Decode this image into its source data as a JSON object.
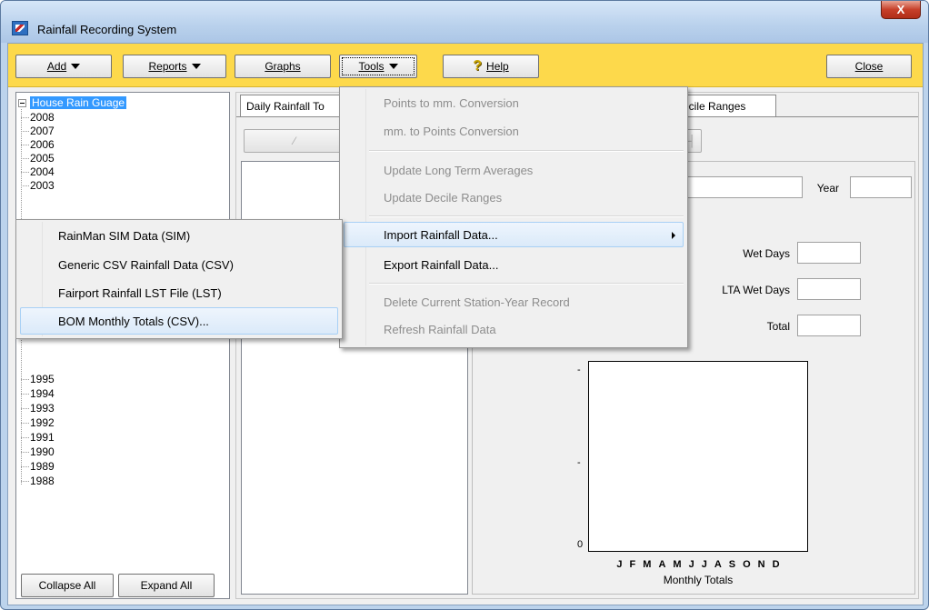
{
  "window": {
    "title": "Rainfall Recording System",
    "close_glyph": "X"
  },
  "toolbar": {
    "add": "Add",
    "reports": "Reports",
    "graphs": "Graphs",
    "tools": "Tools",
    "help": "Help",
    "close": "Close"
  },
  "tree": {
    "root": "House Rain Guage",
    "years_top": [
      "2008",
      "2007",
      "2006",
      "2005",
      "2004",
      "2003"
    ],
    "years_bottom": [
      "1995",
      "1994",
      "1993",
      "1992",
      "1991",
      "1990",
      "1989",
      "1988"
    ],
    "collapse_all": "Collapse All",
    "expand_all": "Expand All"
  },
  "tabs": {
    "daily": "Daily Rainfall To",
    "decile": "ecile Ranges"
  },
  "fields": {
    "year": "Year",
    "wet_days": "Wet Days",
    "lta_wet_days": "LTA Wet Days",
    "total": "Total"
  },
  "chart": {
    "y_zero": "0",
    "y_dash": "-",
    "months": [
      "J",
      "F",
      "M",
      "A",
      "M",
      "J",
      "J",
      "A",
      "S",
      "O",
      "N",
      "D"
    ],
    "caption": "Monthly Totals"
  },
  "tools_menu": {
    "points_to_mm": "Points to mm. Conversion",
    "mm_to_points": "mm. to Points Conversion",
    "update_lta": "Update Long Term Averages",
    "update_decile": "Update Decile Ranges",
    "import": "Import Rainfall Data...",
    "export": "Export Rainfall Data...",
    "delete": "Delete Current Station-Year Record",
    "refresh": "Refresh Rainfall Data"
  },
  "import_menu": {
    "sim": "RainMan SIM Data (SIM)",
    "csv": "Generic CSV Rainfall Data (CSV)",
    "lst": "Fairport Rainfall LST File (LST)",
    "bom": "BOM Monthly Totals (CSV)..."
  }
}
